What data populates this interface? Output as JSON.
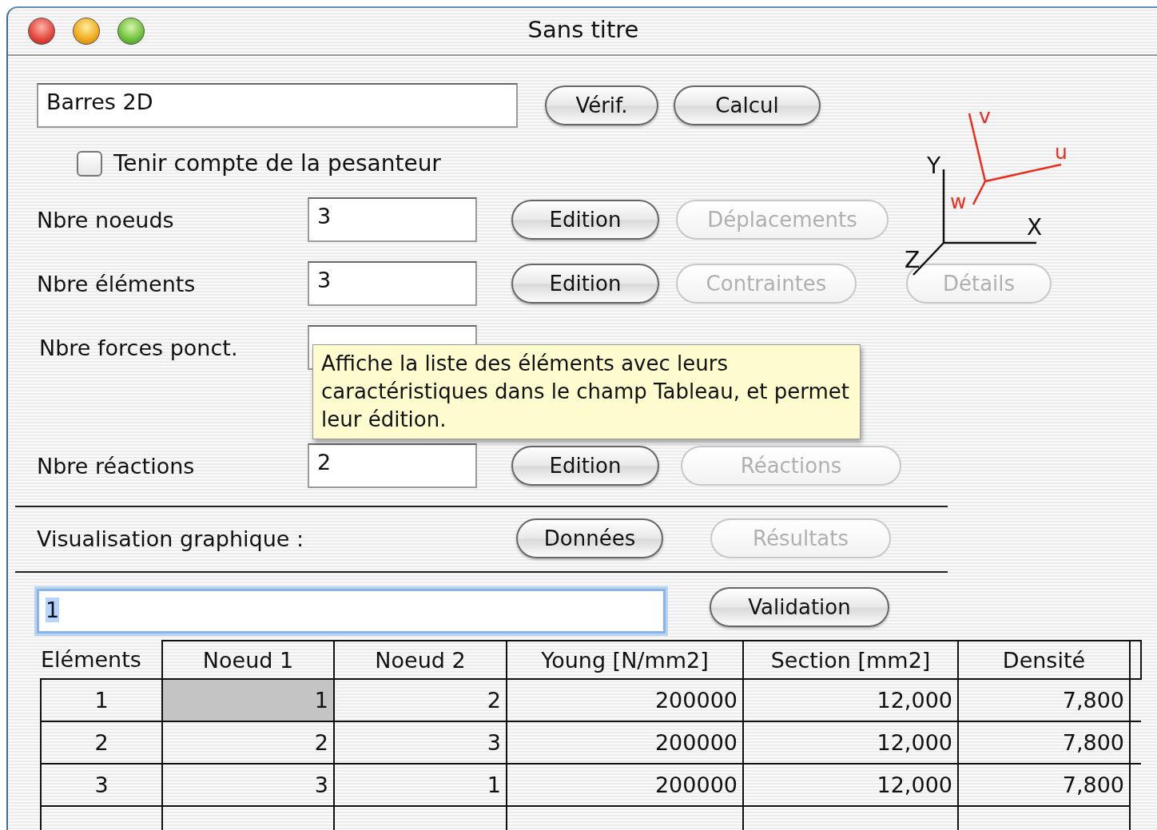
{
  "window": {
    "title": "Sans titre"
  },
  "name_field": {
    "value": "Barres 2D"
  },
  "top_buttons": [
    {
      "label": "Vérif.",
      "disabled": false
    },
    {
      "label": "Calcul",
      "disabled": false
    }
  ],
  "axes": {
    "global": [
      "X",
      "Y",
      "Z"
    ],
    "local": [
      "u",
      "v",
      "w"
    ]
  },
  "gravity_checkbox": {
    "label": "Tenir compte de la pesanteur",
    "checked": false
  },
  "count_rows": [
    {
      "label": "Nbre noeuds",
      "value": "3",
      "buttons": [
        {
          "label": "Edition",
          "disabled": false
        },
        {
          "label": "Déplacements",
          "disabled": true
        }
      ]
    },
    {
      "label": "Nbre éléments",
      "value": "3",
      "buttons": [
        {
          "label": "Edition",
          "disabled": false
        },
        {
          "label": "Contraintes",
          "disabled": true
        },
        {
          "label": "Détails",
          "disabled": true
        }
      ]
    },
    {
      "label": "Nbre forces ponct."
    },
    {
      "label": "Nbre réactions",
      "value": "2",
      "buttons": [
        {
          "label": "Edition",
          "disabled": false
        },
        {
          "label": "Réactions",
          "disabled": true
        }
      ]
    }
  ],
  "tooltip": {
    "text": "Affiche la liste des éléments avec leurs caractéristiques dans le champ Tableau, et permet leur édition."
  },
  "visualisation": {
    "label": "Visualisation graphique :",
    "buttons": [
      {
        "label": "Données",
        "disabled": false
      },
      {
        "label": "Résultats",
        "disabled": true
      }
    ]
  },
  "table_field": {
    "value": "1",
    "focused": true
  },
  "validation_button": {
    "label": "Validation",
    "disabled": false
  },
  "table": {
    "row_header_title": "Eléments",
    "columns": [
      "Noeud 1",
      "Noeud 2",
      "Young [N/mm2]",
      "Section [mm2]",
      "Densité"
    ],
    "rows": [
      {
        "label": "1",
        "cells": [
          {
            "text": "1",
            "selected": true
          },
          {
            "text": "2",
            "selected": false
          },
          {
            "text": "200000",
            "selected": false
          },
          {
            "text": "12,000",
            "selected": false
          },
          {
            "text": "7,800",
            "selected": false
          }
        ]
      },
      {
        "label": "2",
        "cells": [
          {
            "text": "2",
            "selected": false
          },
          {
            "text": "3",
            "selected": false
          },
          {
            "text": "200000",
            "selected": false
          },
          {
            "text": "12,000",
            "selected": false
          },
          {
            "text": "7,800",
            "selected": false
          }
        ]
      },
      {
        "label": "3",
        "cells": [
          {
            "text": "3",
            "selected": false
          },
          {
            "text": "1",
            "selected": false
          },
          {
            "text": "200000",
            "selected": false
          },
          {
            "text": "12,000",
            "selected": false
          },
          {
            "text": "7,800",
            "selected": false
          }
        ]
      }
    ]
  }
}
